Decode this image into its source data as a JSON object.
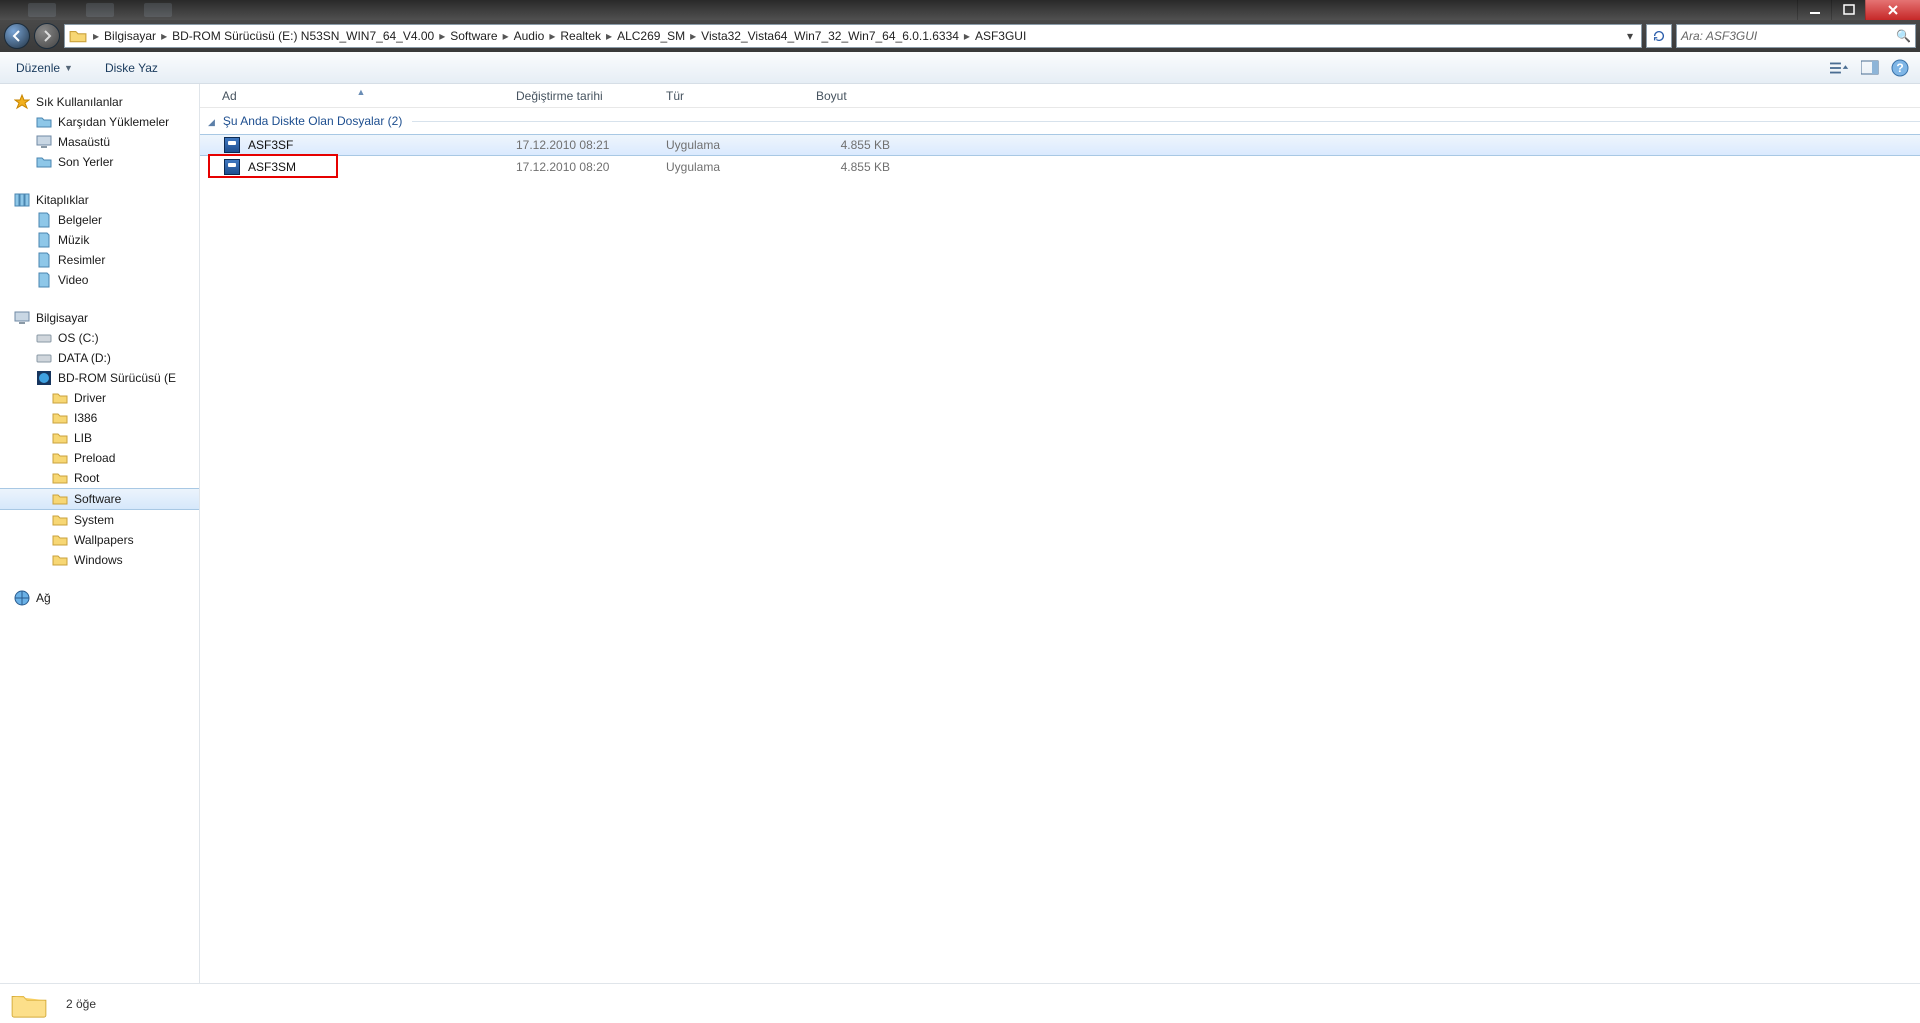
{
  "titlebar": {
    "minimize": "min",
    "maximize": "max",
    "close": "close"
  },
  "breadcrumbs": [
    "Bilgisayar",
    "BD-ROM Sürücüsü (E:) N53SN_WIN7_64_V4.00",
    "Software",
    "Audio",
    "Realtek",
    "ALC269_SM",
    "Vista32_Vista64_Win7_32_Win7_64_6.0.1.6334",
    "ASF3GUI"
  ],
  "search": {
    "placeholder": "Ara: ASF3GUI"
  },
  "toolbar": {
    "organize": "Düzenle",
    "burn": "Diske Yaz"
  },
  "columns": {
    "name": "Ad",
    "date": "Değiştirme tarihi",
    "type": "Tür",
    "size": "Boyut"
  },
  "group": {
    "label": "Şu Anda Diskte Olan Dosyalar (2)"
  },
  "files": [
    {
      "name": "ASF3SF",
      "date": "17.12.2010 08:21",
      "type": "Uygulama",
      "size": "4.855 KB",
      "selected": true
    },
    {
      "name": "ASF3SM",
      "date": "17.12.2010 08:20",
      "type": "Uygulama",
      "size": "4.855 KB",
      "highlighted": true
    }
  ],
  "sidebar": {
    "favorites": {
      "label": "Sık Kullanılanlar",
      "items": [
        {
          "label": "Karşıdan Yüklemeler",
          "icon": "folder-blue"
        },
        {
          "label": "Masaüstü",
          "icon": "desktop"
        },
        {
          "label": "Son Yerler",
          "icon": "folder-blue"
        }
      ]
    },
    "libraries": {
      "label": "Kitaplıklar",
      "items": [
        {
          "label": "Belgeler",
          "icon": "lib"
        },
        {
          "label": "Müzik",
          "icon": "lib"
        },
        {
          "label": "Resimler",
          "icon": "lib"
        },
        {
          "label": "Video",
          "icon": "lib"
        }
      ]
    },
    "computer": {
      "label": "Bilgisayar",
      "items": [
        {
          "label": "OS (C:)",
          "icon": "drive"
        },
        {
          "label": "DATA (D:)",
          "icon": "drive"
        },
        {
          "label": "BD-ROM Sürücüsü (E",
          "icon": "bd"
        }
      ],
      "subitems": [
        {
          "label": "Driver"
        },
        {
          "label": "I386"
        },
        {
          "label": "LIB"
        },
        {
          "label": "Preload"
        },
        {
          "label": "Root"
        },
        {
          "label": "Software",
          "selected": true
        },
        {
          "label": "System"
        },
        {
          "label": "Wallpapers"
        },
        {
          "label": "Windows"
        }
      ]
    },
    "network": {
      "label": "Ağ"
    }
  },
  "status": {
    "count": "2 öğe"
  }
}
